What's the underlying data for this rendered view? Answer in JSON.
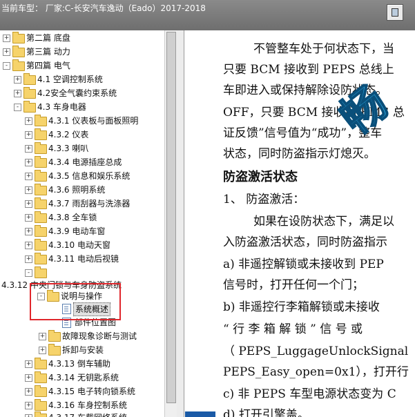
{
  "title": "当前车型：  厂家:C-长安汽车逸动（Eado）2017-2018",
  "tree": {
    "items": [
      {
        "label": "第二篇 底盘",
        "exp": "+"
      },
      {
        "label": "第三篇 动力",
        "exp": "+"
      },
      {
        "label": "第四篇 电气",
        "exp": "-"
      },
      {
        "label": "4.1 空调控制系统",
        "exp": "+"
      },
      {
        "label": "4.2安全气囊约束系统",
        "exp": "+"
      },
      {
        "label": "4.3 车身电器",
        "exp": "-"
      },
      {
        "label": "4.3.1 仪表板与面板照明",
        "exp": "+"
      },
      {
        "label": "4.3.2 仪表",
        "exp": "+"
      },
      {
        "label": "4.3.3 喇叭",
        "exp": "+"
      },
      {
        "label": "4.3.4 电源插座总成",
        "exp": "+"
      },
      {
        "label": "4.3.5 信息和娱乐系统",
        "exp": "+"
      },
      {
        "label": "4.3.6 照明系统",
        "exp": "+"
      },
      {
        "label": "4.3.7 雨刮器与洗涤器",
        "exp": "+"
      },
      {
        "label": "4.3.8 全车锁",
        "exp": "+"
      },
      {
        "label": "4.3.9 电动车窗",
        "exp": "+"
      },
      {
        "label": "4.3.10 电动天窗",
        "exp": "+"
      },
      {
        "label": "4.3.11 电动后视镜",
        "exp": "+"
      },
      {
        "label": "",
        "exp": "-"
      },
      {
        "label": "4.3.12 中央门锁与车身防盗系统",
        "exp": ""
      },
      {
        "label": "说明与操作",
        "exp": "-"
      },
      {
        "label": "系统概述",
        "exp": ""
      },
      {
        "label": "部件位置图",
        "exp": ""
      },
      {
        "label": "故障现象诊断与测试",
        "exp": "+"
      },
      {
        "label": "拆卸与安装",
        "exp": "+"
      },
      {
        "label": "4.3.13 倒车辅助",
        "exp": "+"
      },
      {
        "label": "4.3.14 无钥匙系统",
        "exp": "+"
      },
      {
        "label": "4.3.15 电子转向锁系统",
        "exp": "+"
      },
      {
        "label": "4.3.16 车身控制系统",
        "exp": "+"
      },
      {
        "label": "4.3.17 车载网络系统",
        "exp": "+"
      }
    ]
  },
  "doc": {
    "lines": [
      "不管整车处于何状态下，当",
      "只要 BCM 接收到 PEPS 总线上",
      "车即进入或保持解除设防状态。",
      "OFF，只要 BCM 接收到 EMS 总",
      "证反馈”信号值为“成功”，整车",
      "状态，同时防盗指示灯熄灭。",
      "防盗激活状态",
      "1、  防盗激活：",
      "如果在设防状态下，满足以",
      "入防盗激活状态，同时防盗指示",
      "a) 非遥控解锁或未接收到 PEP",
      "信号时，打开任何一个门；",
      "b) 非遥控行李箱解锁或未接收",
      "“ 行 李 箱 解 锁 ” 信 号 或",
      "（ PEPS_LuggageUnlockSignal",
      "PEPS_Easy_open=0x1），打开行",
      "c) 非 PEPS 车型电源状态变为 C",
      "d) 打开引擎盖。"
    ],
    "watermark": "畅"
  }
}
